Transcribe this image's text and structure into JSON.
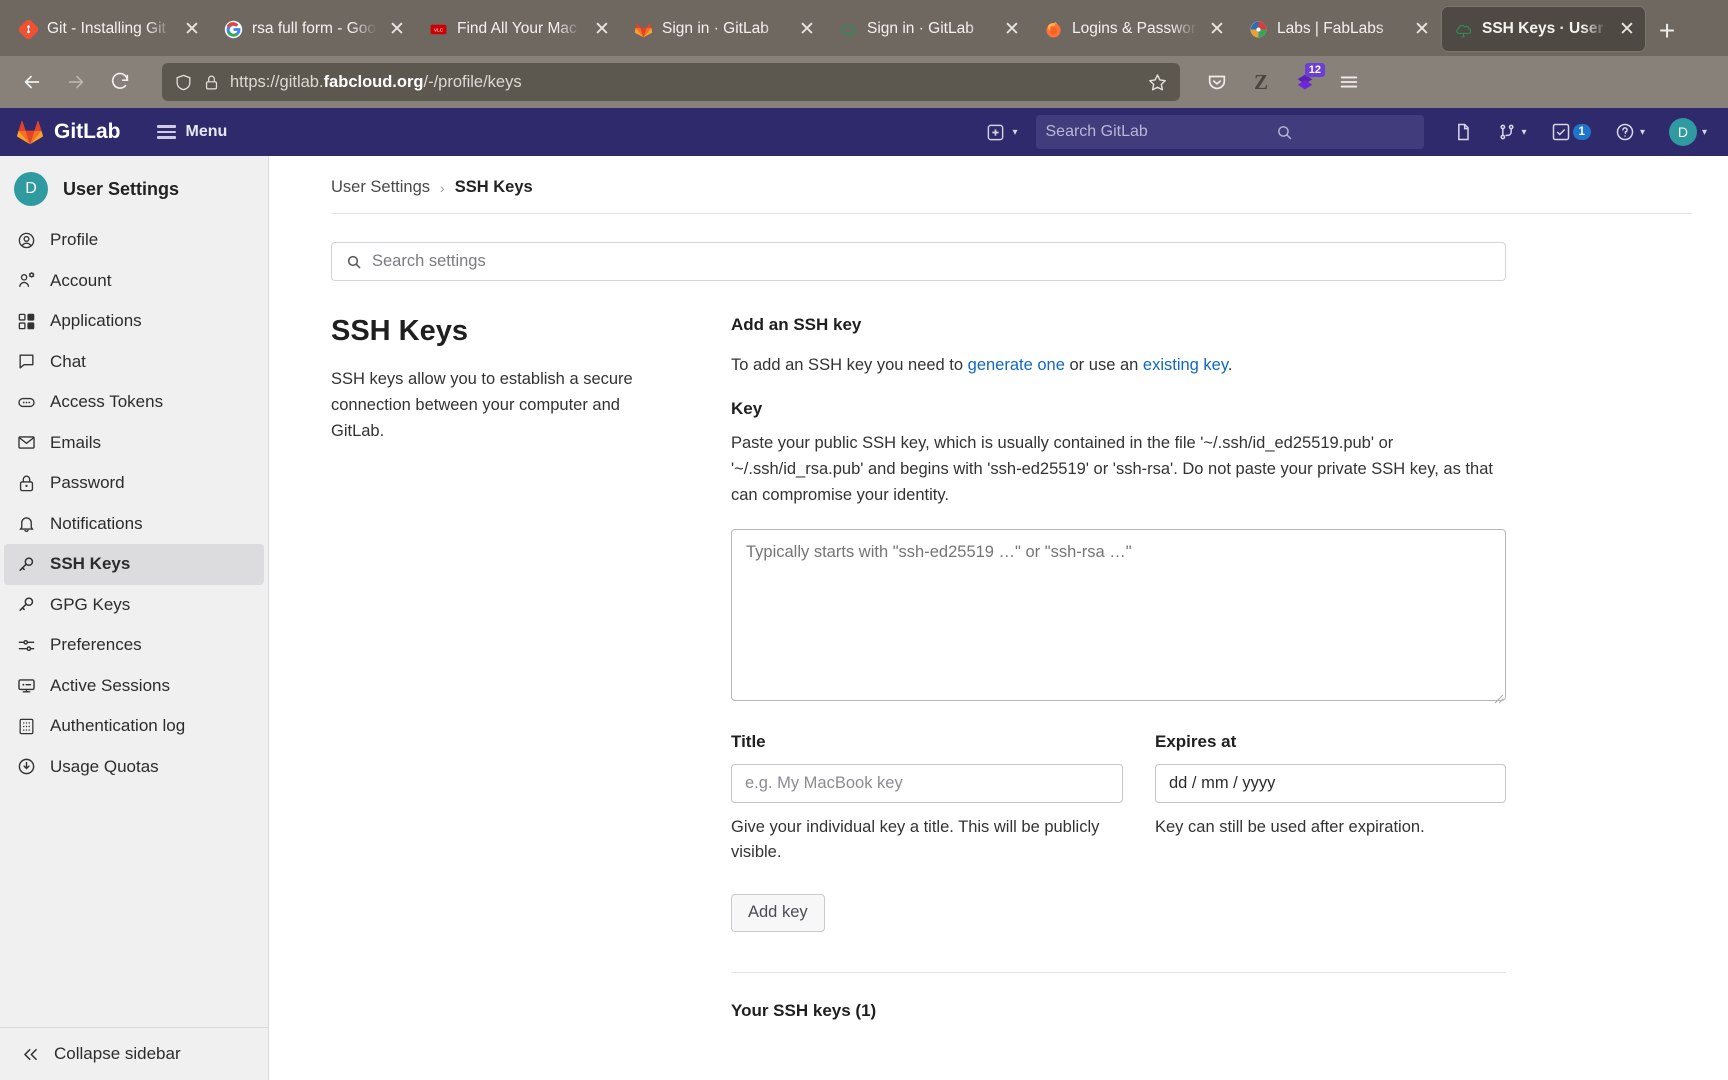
{
  "browser": {
    "tabs": [
      {
        "title": "Git - Installing Git",
        "favicon": "git-icon",
        "active": false
      },
      {
        "title": "rsa full form - Goog",
        "favicon": "google-icon",
        "active": false
      },
      {
        "title": "Find All Your Mac S",
        "favicon": "vlc-icon",
        "active": false
      },
      {
        "title": "Sign in · GitLab",
        "favicon": "gitlab-icon",
        "active": false
      },
      {
        "title": "Sign in · GitLab",
        "favicon": "fabcloud-icon",
        "active": false
      },
      {
        "title": "Logins & Password",
        "favicon": "firefox-icon",
        "active": false
      },
      {
        "title": "Labs | FabLabs",
        "favicon": "fablabs-icon",
        "active": false
      },
      {
        "title": "SSH Keys · User Se",
        "favicon": "fabcloud-icon",
        "active": true
      }
    ],
    "new_tab_label": "+",
    "close_label": "✕",
    "nav": {
      "back": "back-arrow",
      "forward": "forward-arrow",
      "reload": "reload-arrow"
    },
    "url": {
      "prefix": "https://gitlab.",
      "domain": "fabcloud.org",
      "path": "/-/profile/keys"
    },
    "extensions": {
      "pocket": "pocket-icon",
      "zotero": "Z",
      "downloads_badge": "12"
    }
  },
  "gitlab_nav": {
    "brand": "GitLab",
    "menu_label": "Menu",
    "search_placeholder": "Search GitLab",
    "merge_badge": "",
    "todos_badge": "1",
    "avatar_initial": "D"
  },
  "sidebar": {
    "avatar_initial": "D",
    "title": "User Settings",
    "items": [
      {
        "label": "Profile",
        "icon": "user-circle-icon",
        "active": false
      },
      {
        "label": "Account",
        "icon": "user-gear-icon",
        "active": false
      },
      {
        "label": "Applications",
        "icon": "apps-grid-icon",
        "active": false
      },
      {
        "label": "Chat",
        "icon": "comment-icon",
        "active": false
      },
      {
        "label": "Access Tokens",
        "icon": "token-icon",
        "active": false
      },
      {
        "label": "Emails",
        "icon": "envelope-icon",
        "active": false
      },
      {
        "label": "Password",
        "icon": "lock-icon",
        "active": false
      },
      {
        "label": "Notifications",
        "icon": "bell-icon",
        "active": false
      },
      {
        "label": "SSH Keys",
        "icon": "key-icon",
        "active": true
      },
      {
        "label": "GPG Keys",
        "icon": "key-icon",
        "active": false
      },
      {
        "label": "Preferences",
        "icon": "sliders-icon",
        "active": false
      },
      {
        "label": "Active Sessions",
        "icon": "monitor-icon",
        "active": false
      },
      {
        "label": "Authentication log",
        "icon": "log-grid-icon",
        "active": false
      },
      {
        "label": "Usage Quotas",
        "icon": "quota-icon",
        "active": false
      }
    ],
    "collapse_label": "Collapse sidebar"
  },
  "breadcrumb": {
    "parent": "User Settings",
    "separator": "›",
    "current": "SSH Keys"
  },
  "settings_search": {
    "placeholder": "Search settings",
    "icon": "search-icon"
  },
  "main": {
    "heading": "SSH Keys",
    "description": "SSH keys allow you to establish a secure connection between your computer and GitLab.",
    "add_key": {
      "heading": "Add an SSH key",
      "intro_before": "To add an SSH key you need to ",
      "link_generate": "generate one",
      "intro_middle": " or use an ",
      "link_existing": "existing key",
      "intro_after": ".",
      "key_label": "Key",
      "key_help": "Paste your public SSH key, which is usually contained in the file '~/.ssh/id_ed25519.pub' or '~/.ssh/id_rsa.pub' and begins with 'ssh-ed25519' or 'ssh-rsa'. Do not paste your private SSH key, as that can compromise your identity.",
      "key_placeholder": "Typically starts with \"ssh-ed25519 …\" or \"ssh-rsa …\"",
      "key_value": "",
      "title_label": "Title",
      "title_placeholder": "e.g. My MacBook key",
      "title_value": "",
      "title_help": "Give your individual key a title. This will be publicly visible.",
      "expires_label": "Expires at",
      "expires_placeholder": "dd / mm / yyyy",
      "expires_value": "",
      "expires_help": "Key can still be used after expiration.",
      "submit_label": "Add key"
    },
    "your_keys_heading": "Your SSH keys (1)"
  },
  "colors": {
    "gitlab_navy": "#2f2a6b",
    "gitlab_orange": "#e24329",
    "link_blue": "#1068bf",
    "avatar_teal": "#2f9a9f",
    "chrome_brown": "#6e6860"
  }
}
